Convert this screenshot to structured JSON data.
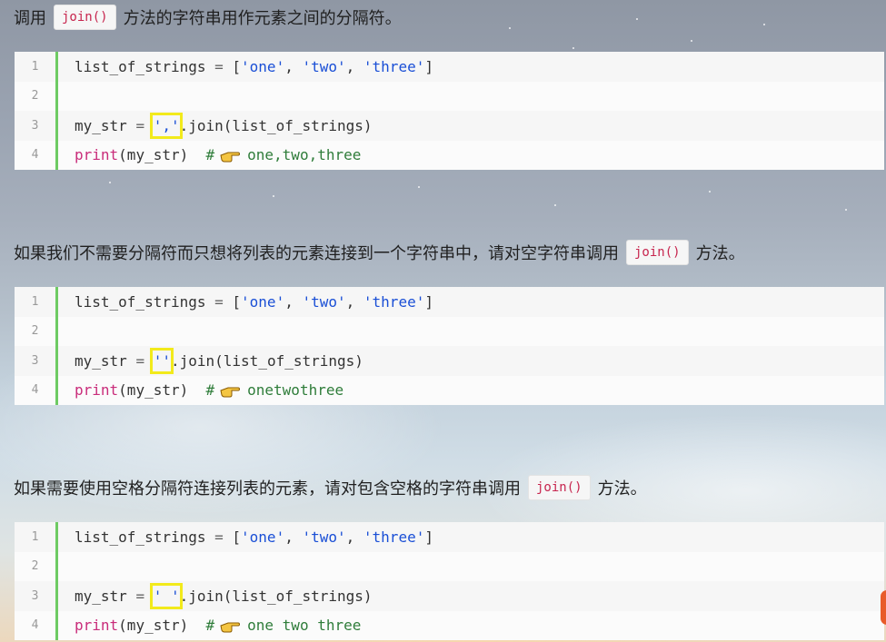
{
  "intro": {
    "prefix": "调用",
    "code": "join()",
    "suffix": "方法的字符串用作元素之间的分隔符。"
  },
  "blocks": [
    {
      "line_numbers": [
        "1",
        "2",
        "3",
        "4"
      ],
      "l1": {
        "a": "list_of_strings ",
        "eq": "=",
        "b": " [",
        "s1": "'one'",
        "c1": ", ",
        "s2": "'two'",
        "c2": ", ",
        "s3": "'three'",
        "end": "]"
      },
      "l3": {
        "a": "my_str ",
        "eq": "=",
        "sp": " ",
        "sep": "','",
        "rest": ".join(list_of_strings)"
      },
      "l4": {
        "kw": "print",
        "args": "(my_str)",
        "hash": "#",
        "output": "one,two,three"
      }
    },
    {
      "line_numbers": [
        "1",
        "2",
        "3",
        "4"
      ],
      "l1": {
        "a": "list_of_strings ",
        "eq": "=",
        "b": " [",
        "s1": "'one'",
        "c1": ", ",
        "s2": "'two'",
        "c2": ", ",
        "s3": "'three'",
        "end": "]"
      },
      "l3": {
        "a": "my_str ",
        "eq": "=",
        "sp": " ",
        "sep": "''",
        "rest": ".join(list_of_strings)"
      },
      "l4": {
        "kw": "print",
        "args": "(my_str)",
        "hash": "#",
        "output": "onetwothree"
      }
    },
    {
      "line_numbers": [
        "1",
        "2",
        "3",
        "4"
      ],
      "l1": {
        "a": "list_of_strings ",
        "eq": "=",
        "b": " [",
        "s1": "'one'",
        "c1": ", ",
        "s2": "'two'",
        "c2": ", ",
        "s3": "'three'",
        "end": "]"
      },
      "l3": {
        "a": "my_str ",
        "eq": "=",
        "sp": " ",
        "sep": "' '",
        "rest": ".join(list_of_strings)"
      },
      "l4": {
        "kw": "print",
        "args": "(my_str)",
        "hash": "#",
        "output": "one two three"
      }
    }
  ],
  "para2": {
    "prefix": "如果我们不需要分隔符而只想将列表的元素连接到一个字符串中，请对空字符串调用",
    "code": "join()",
    "suffix": "方法。"
  },
  "para3": {
    "prefix": "如果需要使用空格分隔符连接列表的元素，请对包含空格的字符串调用",
    "code": "join()",
    "suffix": "方法。"
  },
  "icons": {
    "pointer": "pointing-hand-icon"
  },
  "colors": {
    "line_number_bar": "#6ecb63",
    "string": "#1a4fd6",
    "keyword": "#c92c7a",
    "comment": "#2f7d3a",
    "highlight_box": "#f2ea1b",
    "inline_code": "#c7254e"
  }
}
